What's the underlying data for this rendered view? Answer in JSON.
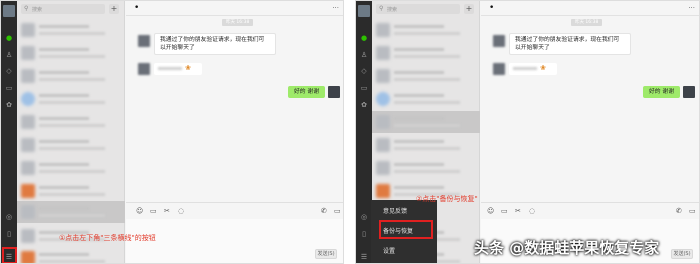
{
  "search": {
    "placeholder": "搜索",
    "add_label": "+"
  },
  "chat": {
    "title": "•",
    "timestamp": "昨天 16:38",
    "greeting": [
      "我通过了你的朋友验证请求，现在我们可",
      "以开始聊天了"
    ],
    "reply": "好的 谢谢",
    "send_label": "发送(S)"
  },
  "annotations": {
    "step1": "①点击左下角\"三条横线\"的按钮",
    "step2": "②点击\"备份与恢复\""
  },
  "menu": {
    "items": [
      "意见反馈",
      "备份与恢复",
      "设置"
    ]
  },
  "watermark": "头条 @数据蛙苹果恢复专家",
  "colors": {
    "accent": "#2dc100",
    "bubble_out": "#9eea6a",
    "annotation": "#e02020",
    "rail": "#2b2b2b"
  }
}
